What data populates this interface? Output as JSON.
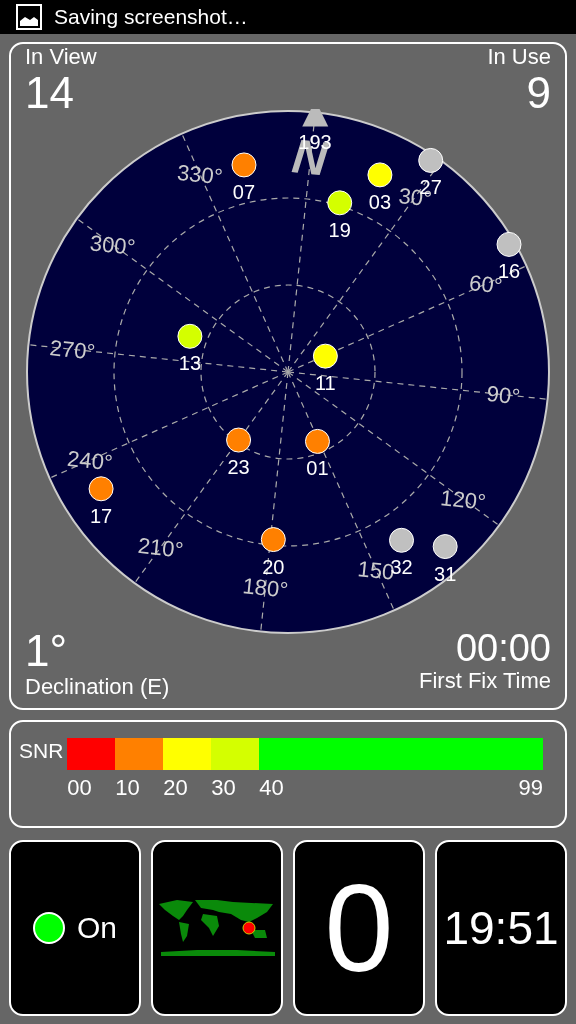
{
  "status_bar": {
    "notification": "Saving screenshot…"
  },
  "sky": {
    "in_view_label": "In View",
    "in_view": "14",
    "in_use_label": "In Use",
    "in_use": "9",
    "declination": "1°",
    "declination_label": "Declination (E)",
    "first_fix": "00:00",
    "first_fix_label": "First Fix Time",
    "north_label": "N",
    "compass_labels": [
      {
        "text": "330°"
      },
      {
        "text": "300°"
      },
      {
        "text": "270°"
      },
      {
        "text": "240°"
      },
      {
        "text": "210°"
      },
      {
        "text": "180°"
      },
      {
        "text": "150"
      },
      {
        "text": "120°"
      },
      {
        "text": "90°"
      },
      {
        "text": "60°"
      },
      {
        "text": "30°"
      }
    ],
    "satellites": [
      {
        "id": "193",
        "kind": "label"
      },
      {
        "id": "07",
        "kind": "dot",
        "color": "#ff8000"
      },
      {
        "id": "19",
        "kind": "dot",
        "color": "#d4ff00"
      },
      {
        "id": "03",
        "kind": "dot",
        "color": "#ffff00"
      },
      {
        "id": "27",
        "kind": "dot",
        "color": "#c0c0c0"
      },
      {
        "id": "16",
        "kind": "dot",
        "color": "#c0c0c0"
      },
      {
        "id": "13",
        "kind": "dot",
        "color": "#d4ff00"
      },
      {
        "id": "11",
        "kind": "dot",
        "color": "#ffff00"
      },
      {
        "id": "23",
        "kind": "dot",
        "color": "#ff8000"
      },
      {
        "id": "01",
        "kind": "dot",
        "color": "#ff8000"
      },
      {
        "id": "17",
        "kind": "dot",
        "color": "#ff8000"
      },
      {
        "id": "20",
        "kind": "dot",
        "color": "#ff8000"
      },
      {
        "id": "32",
        "kind": "dot",
        "color": "#c0c0c0"
      },
      {
        "id": "31",
        "kind": "dot",
        "color": "#c0c0c0"
      }
    ]
  },
  "snr": {
    "label": "SNR",
    "segments": [
      {
        "label": "00",
        "color": "#ff0000"
      },
      {
        "label": "10",
        "color": "#ff8000"
      },
      {
        "label": "20",
        "color": "#ffff00"
      },
      {
        "label": "30",
        "color": "#d4ff00"
      },
      {
        "label": "40",
        "color": "#00ff00"
      }
    ],
    "end_label": "99"
  },
  "tiles": {
    "gps": {
      "on": true,
      "label": "On"
    },
    "satellites_count": "0",
    "time": "19:51"
  }
}
